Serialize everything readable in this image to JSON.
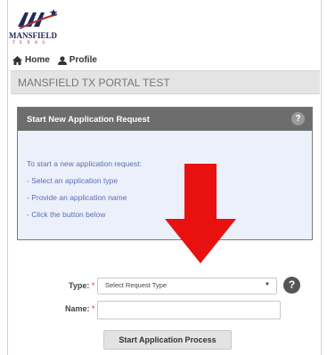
{
  "logo": {
    "name": "MANSFIELD",
    "subtitle": "TEXAS"
  },
  "nav": {
    "home": "Home",
    "profile": "Profile"
  },
  "portal": {
    "title": "MANSFIELD TX PORTAL TEST"
  },
  "panel": {
    "title": "Start New Application Request",
    "help": "?",
    "lines": [
      "To start a new application request:",
      "- Select an application type",
      "- Provide an application name",
      "- Click the button below"
    ]
  },
  "form": {
    "type_label": "Type:",
    "name_label": "Name:",
    "required_mark": "*",
    "type_value": "Select Request Type",
    "caret": "▼",
    "help": "?",
    "name_value": ""
  },
  "button": {
    "start_label": "Start Application Process"
  },
  "colors": {
    "arrow": "#e8110f",
    "panel_header": "#6d6d6d",
    "panel_bg": "#ecf0fb",
    "instruction_text": "#5a6fb0"
  }
}
